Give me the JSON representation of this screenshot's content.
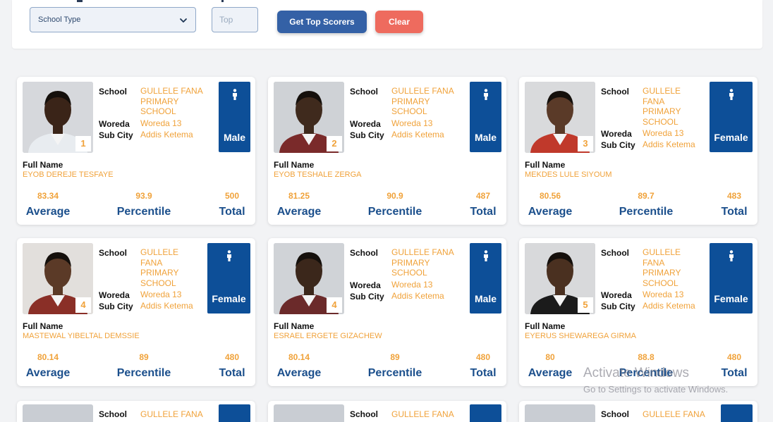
{
  "filters": {
    "school_type": {
      "value": "School Type"
    },
    "top": {
      "placeholder": "Top"
    },
    "get_button": "Get Top Scorers",
    "clear_button": "Clear"
  },
  "labels": {
    "school": "School",
    "woreda": "Woreda",
    "sub_city": "Sub City",
    "full_name": "Full Name",
    "average": "Average",
    "percentile": "Percentile",
    "total": "Total"
  },
  "students": [
    {
      "rank": "1",
      "school": "GULLELE FANA PRIMARY SCHOOL",
      "woreda": "Woreda 13",
      "sub_city": "Addis Ketema",
      "gender": "Male",
      "full_name": "EYOB DEREJE TESFAYE",
      "average": "83.34",
      "percentile": "93.9",
      "total": "500"
    },
    {
      "rank": "2",
      "school": "GULLELE FANA PRIMARY SCHOOL",
      "woreda": "Woreda 13",
      "sub_city": "Addis Ketema",
      "gender": "Male",
      "full_name": "EYOB TESHALE ZERGA",
      "average": "81.25",
      "percentile": "90.9",
      "total": "487"
    },
    {
      "rank": "3",
      "school": "GULLELE FANA PRIMARY SCHOOL",
      "woreda": "Woreda 13",
      "sub_city": "Addis Ketema",
      "gender": "Female",
      "full_name": "MEKDES LULE SIYOUM",
      "average": "80.56",
      "percentile": "89.7",
      "total": "483"
    },
    {
      "rank": "4",
      "school": "GULLELE FANA PRIMARY SCHOOL",
      "woreda": "Woreda 13",
      "sub_city": "Addis Ketema",
      "gender": "Female",
      "full_name": "MASTEWAL YIBELTAL DEMSSIE",
      "average": "80.14",
      "percentile": "89",
      "total": "480"
    },
    {
      "rank": "4",
      "school": "GULLELE FANA PRIMARY SCHOOL",
      "woreda": "Woreda 13",
      "sub_city": "Addis Ketema",
      "gender": "Male",
      "full_name": "ESRAEL ERGETE GIZACHEW",
      "average": "80.14",
      "percentile": "89",
      "total": "480"
    },
    {
      "rank": "5",
      "school": "GULLELE FANA PRIMARY SCHOOL",
      "woreda": "Woreda 13",
      "sub_city": "Addis Ketema",
      "gender": "Female",
      "full_name": "EYERUS SHEWAREGA GIRMA",
      "average": "80",
      "percentile": "88.8",
      "total": "480"
    }
  ],
  "partial_row": {
    "school_label": "School",
    "school_value": "GULLELE FANA"
  },
  "watermark": {
    "title": "Activate Windows",
    "subtitle": "Go to Settings to activate Windows."
  },
  "colors": {
    "accent_orange": "#f0a23a",
    "primary_blue": "#0d4f98",
    "button_blue": "#3461a6",
    "button_red": "#ee6b5e"
  }
}
